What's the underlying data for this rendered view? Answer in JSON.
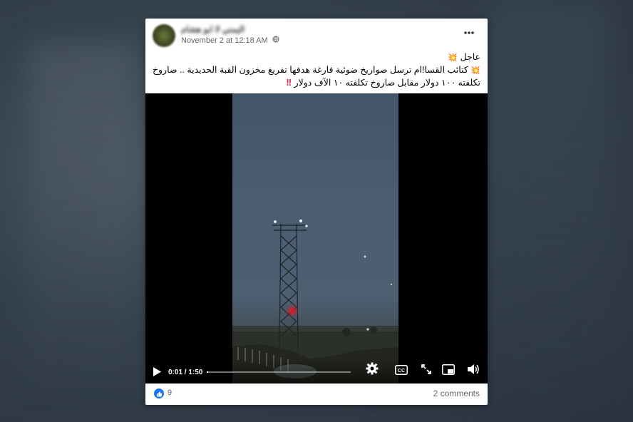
{
  "post": {
    "author": "الشيخ اليمني لا ابو هشام",
    "timestamp": "November 2 at 12:18 AM",
    "audience_icon": "globe-icon",
    "more_icon": "more-options-icon",
    "text_lines": [
      "عاجل",
      "كتائب القسا!ام ترسل صواريخ ضوئية فارغة هدفها تفريغ مخزون القبة الحديدية .. صاروخ",
      "تكلفته ١٠٠ دولار مقابل صاروخ تكلفته ١٠ الآف دولار"
    ],
    "emoji_burst": "💥",
    "emoji_exclaim": "‼"
  },
  "video": {
    "current_time": "0:01",
    "duration": "1:50",
    "time_display": "0:01 / 1:50",
    "progress": 0.01,
    "controls": [
      "play-icon",
      "settings-icon",
      "captions-icon",
      "fullscreen-icon",
      "picture-in-picture-icon",
      "volume-icon"
    ]
  },
  "footer": {
    "like_count": "9",
    "comments": "2 comments"
  },
  "colors": {
    "like_blue": "#1877f2",
    "exclaim_red": "#e41e3f",
    "text": "#050505",
    "meta": "#65676b"
  }
}
